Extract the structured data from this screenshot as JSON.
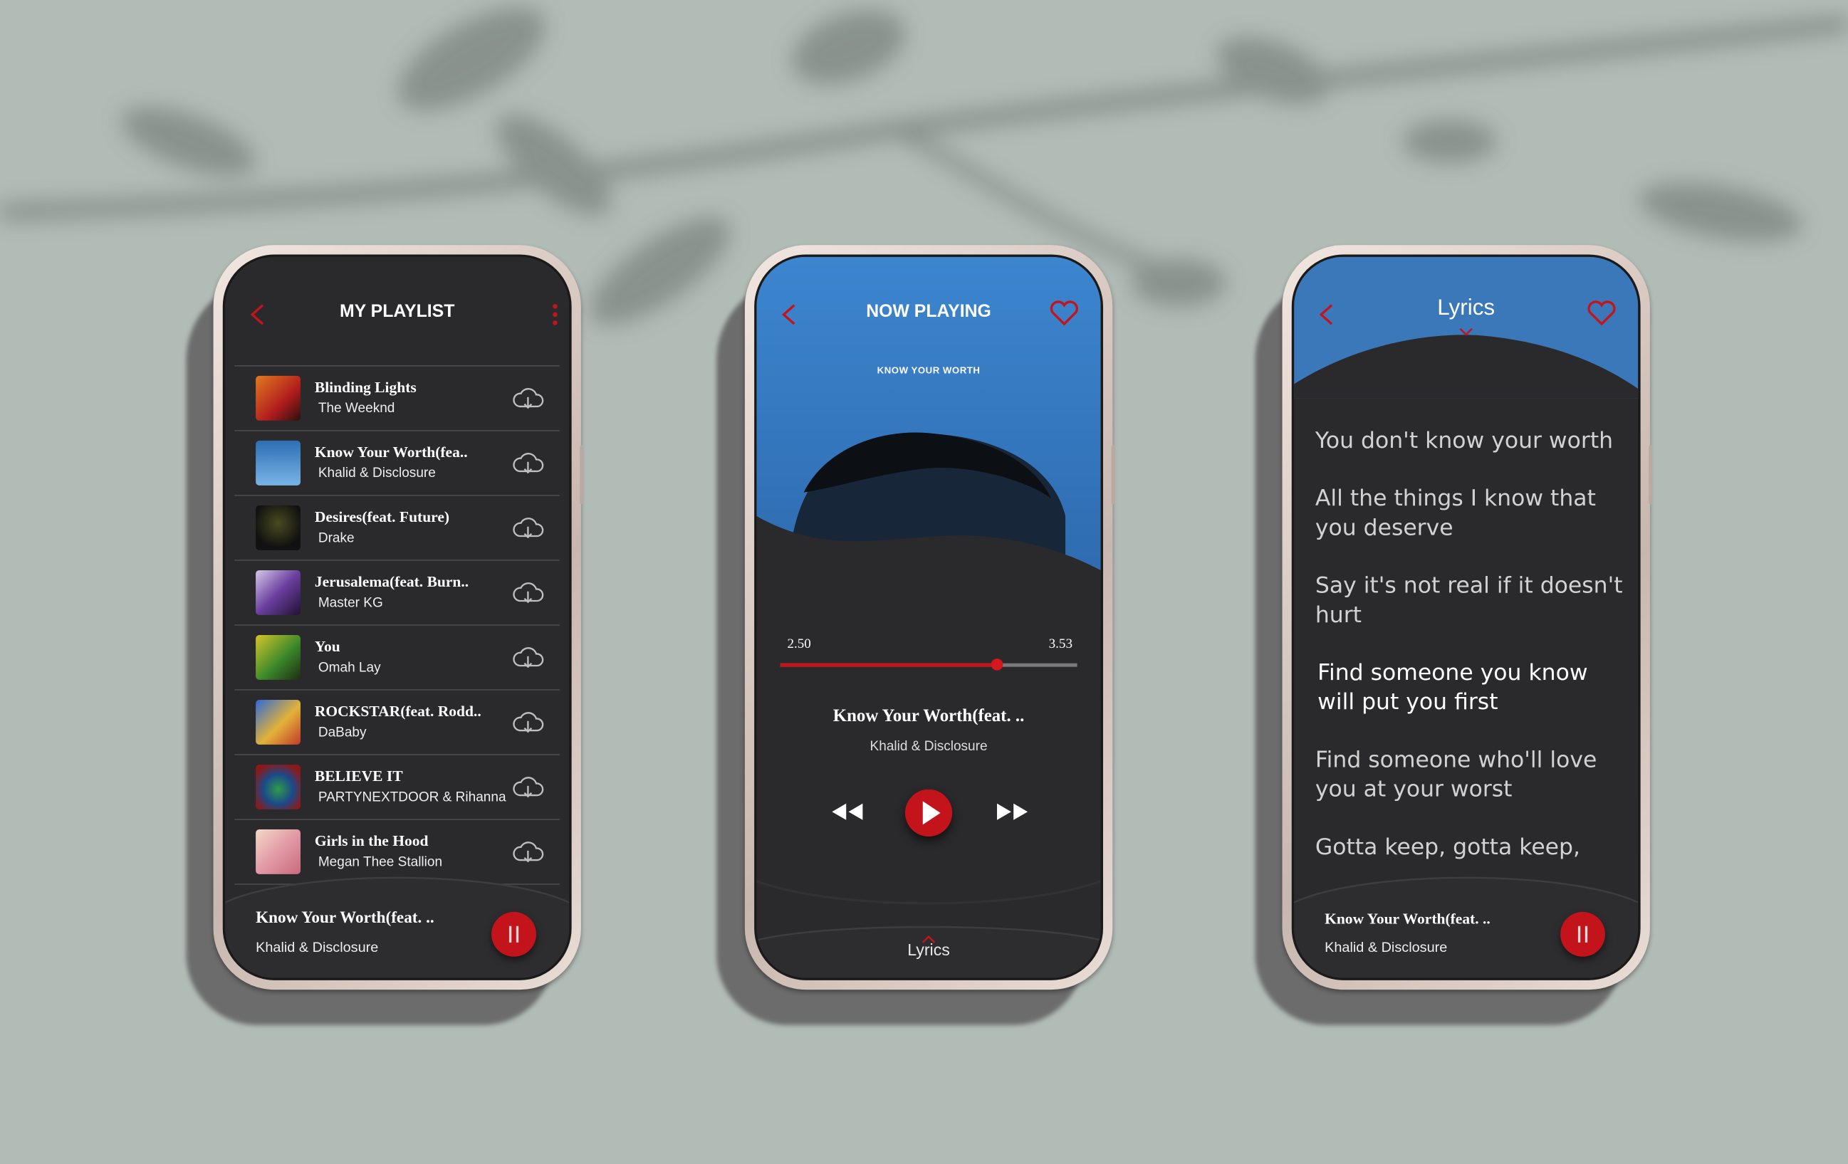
{
  "colors": {
    "accent": "#c3141c",
    "screen_bg": "#2a2a2c",
    "wall": "#b2bcb7",
    "album_blue": "#3f83c4"
  },
  "playlist_screen": {
    "title": "MY PLAYLIST",
    "back_icon": "chevron-left-icon",
    "menu_icon": "kebab-menu-icon",
    "tracks": [
      {
        "title": "Blinding Lights",
        "artist": "The Weeknd"
      },
      {
        "title": "Know Your Worth(fea..",
        "artist": "Khalid & Disclosure"
      },
      {
        "title": "Desires(feat. Future)",
        "artist": "Drake"
      },
      {
        "title": "Jerusalema(feat. Burn..",
        "artist": "Master KG"
      },
      {
        "title": "You",
        "artist": "Omah Lay"
      },
      {
        "title": "ROCKSTAR(feat. Rodd..",
        "artist": "DaBaby"
      },
      {
        "title": "BELIEVE IT",
        "artist": "PARTYNEXTDOOR & Rihanna"
      },
      {
        "title": "Girls in the Hood",
        "artist": "Megan Thee Stallion"
      }
    ],
    "mini_player": {
      "title": "Know Your Worth(feat. ..",
      "artist": "Khalid & Disclosure",
      "icon": "pause-icon"
    }
  },
  "now_playing_screen": {
    "title": "NOW PLAYING",
    "album_text": "KNOW YOUR WORTH",
    "elapsed": "2.50",
    "duration": "3.53",
    "progress": 0.73,
    "track_title": "Know Your Worth(feat. ..",
    "artist": "Khalid & Disclosure",
    "lyrics_tab": "Lyrics"
  },
  "lyrics_screen": {
    "title": "Lyrics",
    "lines": [
      "You don't know your worth",
      "All the things I know that you deserve",
      "Say it's not real if it doesn't hurt",
      "Find someone you know will put you first",
      "Find someone who'll love you at your worst",
      "Gotta keep, gotta keep,"
    ],
    "current_line_index": 3,
    "mini_player": {
      "title": "Know Your Worth(feat. ..",
      "artist": "Khalid & Disclosure",
      "icon": "pause-icon"
    }
  }
}
